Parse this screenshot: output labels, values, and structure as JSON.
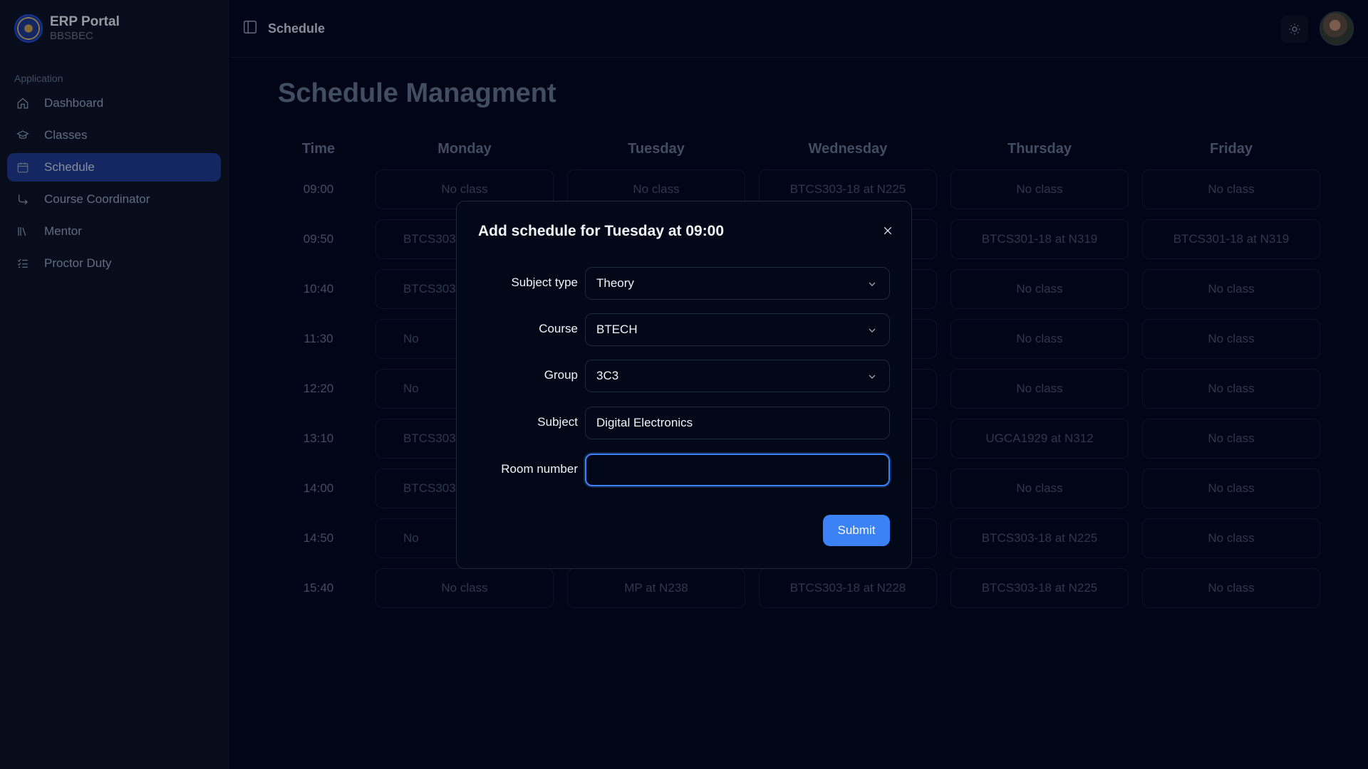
{
  "brand": {
    "title": "ERP Portal",
    "subtitle": "BBSBEC"
  },
  "sidebar": {
    "section_label": "Application",
    "items": [
      {
        "label": "Dashboard",
        "icon": "home-icon"
      },
      {
        "label": "Classes",
        "icon": "graduation-cap-icon"
      },
      {
        "label": "Schedule",
        "icon": "calendar-icon",
        "active": true
      },
      {
        "label": "Course Coordinator",
        "icon": "flow-icon"
      },
      {
        "label": "Mentor",
        "icon": "library-icon"
      },
      {
        "label": "Proctor Duty",
        "icon": "list-check-icon"
      }
    ]
  },
  "header": {
    "title": "Schedule"
  },
  "page": {
    "title": "Schedule Managment"
  },
  "schedule": {
    "time_header": "Time",
    "days": [
      "Monday",
      "Tuesday",
      "Wednesday",
      "Thursday",
      "Friday"
    ],
    "rows": [
      {
        "time": "09:00",
        "cells": [
          "No class",
          "No class",
          "BTCS303-18 at N225",
          "No class",
          "No class"
        ]
      },
      {
        "time": "09:50",
        "cells": [
          "BTCS303",
          "",
          "",
          "BTCS301-18 at N319",
          "BTCS301-18 at N319"
        ]
      },
      {
        "time": "10:40",
        "cells": [
          "BTCS303",
          "",
          "",
          "No class",
          "No class"
        ]
      },
      {
        "time": "11:30",
        "cells": [
          "No",
          "",
          "",
          "No class",
          "No class"
        ]
      },
      {
        "time": "12:20",
        "cells": [
          "No",
          "",
          "",
          "No class",
          "No class"
        ]
      },
      {
        "time": "13:10",
        "cells": [
          "BTCS303",
          "",
          "",
          "UGCA1929 at N312",
          "No class"
        ]
      },
      {
        "time": "14:00",
        "cells": [
          "BTCS303",
          "",
          "",
          "No class",
          "No class"
        ]
      },
      {
        "time": "14:50",
        "cells": [
          "No",
          "",
          "",
          "BTCS303-18 at N225",
          "No class"
        ]
      },
      {
        "time": "15:40",
        "cells": [
          "No class",
          "MP at N238",
          "BTCS303-18 at N228",
          "BTCS303-18 at N225",
          "No class"
        ]
      }
    ]
  },
  "modal": {
    "title": "Add schedule for Tuesday at 09:00",
    "fields": {
      "subject_type": {
        "label": "Subject type",
        "value": "Theory"
      },
      "course": {
        "label": "Course",
        "value": "BTECH"
      },
      "group": {
        "label": "Group",
        "value": "3C3"
      },
      "subject": {
        "label": "Subject",
        "value": "Digital Electronics"
      },
      "room_number": {
        "label": "Room number",
        "value": ""
      }
    },
    "submit_label": "Submit"
  },
  "colors": {
    "accent": "#3b82f6",
    "active_nav": "#1e3a8a",
    "background": "#020617"
  }
}
